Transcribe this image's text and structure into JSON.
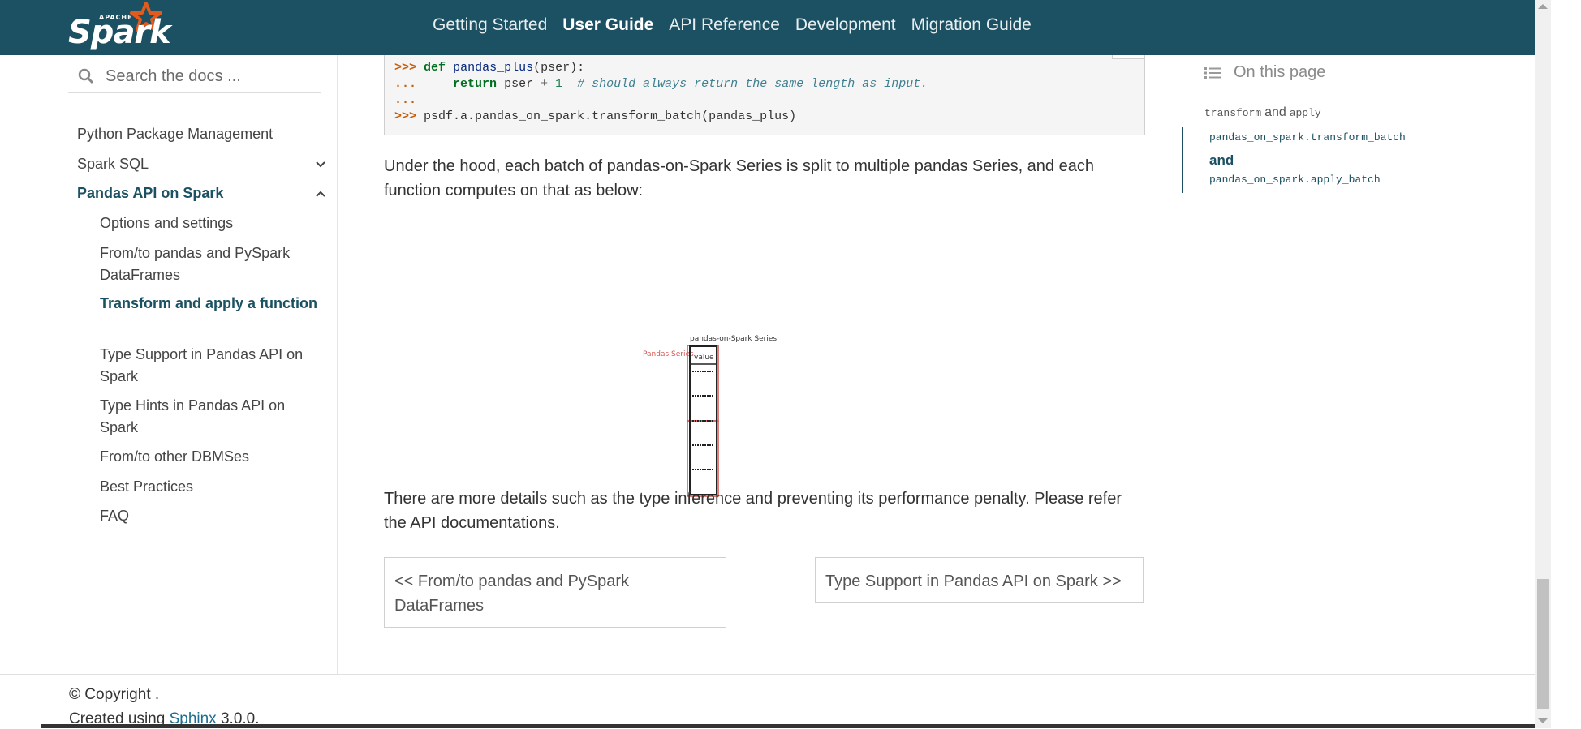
{
  "header": {
    "logo_top": "APACHE",
    "logo_text": "Spark",
    "nav": [
      {
        "label": "Getting Started",
        "active": false
      },
      {
        "label": "User Guide",
        "active": true
      },
      {
        "label": "API Reference",
        "active": false
      },
      {
        "label": "Development",
        "active": false
      },
      {
        "label": "Migration Guide",
        "active": false
      }
    ]
  },
  "sidebar": {
    "search_placeholder": "Search the docs ...",
    "items": [
      {
        "label": "Python Package Management"
      },
      {
        "label": "Spark SQL"
      },
      {
        "label": "Pandas API on Spark"
      },
      {
        "label": "Options and settings"
      },
      {
        "label": "From/to pandas and PySpark DataFrames"
      },
      {
        "label": "Transform and apply a function"
      },
      {
        "label": "Type Support in Pandas API on Spark"
      },
      {
        "label": "Type Hints in Pandas API on Spark"
      },
      {
        "label": "From/to other DBMSes"
      },
      {
        "label": "Best Practices"
      },
      {
        "label": "FAQ"
      }
    ]
  },
  "code": {
    "prompt1": ">>>",
    "kw_def": "def",
    "fn_name": "pandas_plus",
    "args": "(pser):",
    "cont": "...",
    "kw_return": "return",
    "ret_expr": "pser",
    "op_plus": "+",
    "num_one": "1",
    "comment": "# should always return the same length as input.",
    "last_line": "psdf.a.pandas_on_spark.transform_batch(pandas_plus)"
  },
  "content": {
    "para1": "Under the hood, each batch of pandas-on-Spark Series is split to multiple pandas Series, and each function computes on that as below:",
    "figure": {
      "title": "pandas-on-Spark Series",
      "side_label": "Pandas Series",
      "col_label": "value"
    },
    "para2": "There are more details such as the type inference and preventing its performance penalty. Please refer the API documentations.",
    "prev": "<< From/to pandas and PySpark DataFrames",
    "next": "Type Support in Pandas API on Spark >>"
  },
  "toc": {
    "heading": "On this page",
    "item1_a": "transform",
    "item1_and": "and",
    "item1_b": "apply",
    "item2_a": "pandas_on_spark.transform_batch",
    "item2_and": "and",
    "item2_b": "pandas_on_spark.apply_batch"
  },
  "footer": {
    "copyright": "© Copyright .",
    "created_prefix": "Created using",
    "sphinx_link": "Sphinx",
    "version": "3.0.0."
  },
  "colors": {
    "navbar": "#1b5162",
    "accent": "#1b5162",
    "link": "#1b6e91",
    "figure_red": "#d9534f"
  }
}
